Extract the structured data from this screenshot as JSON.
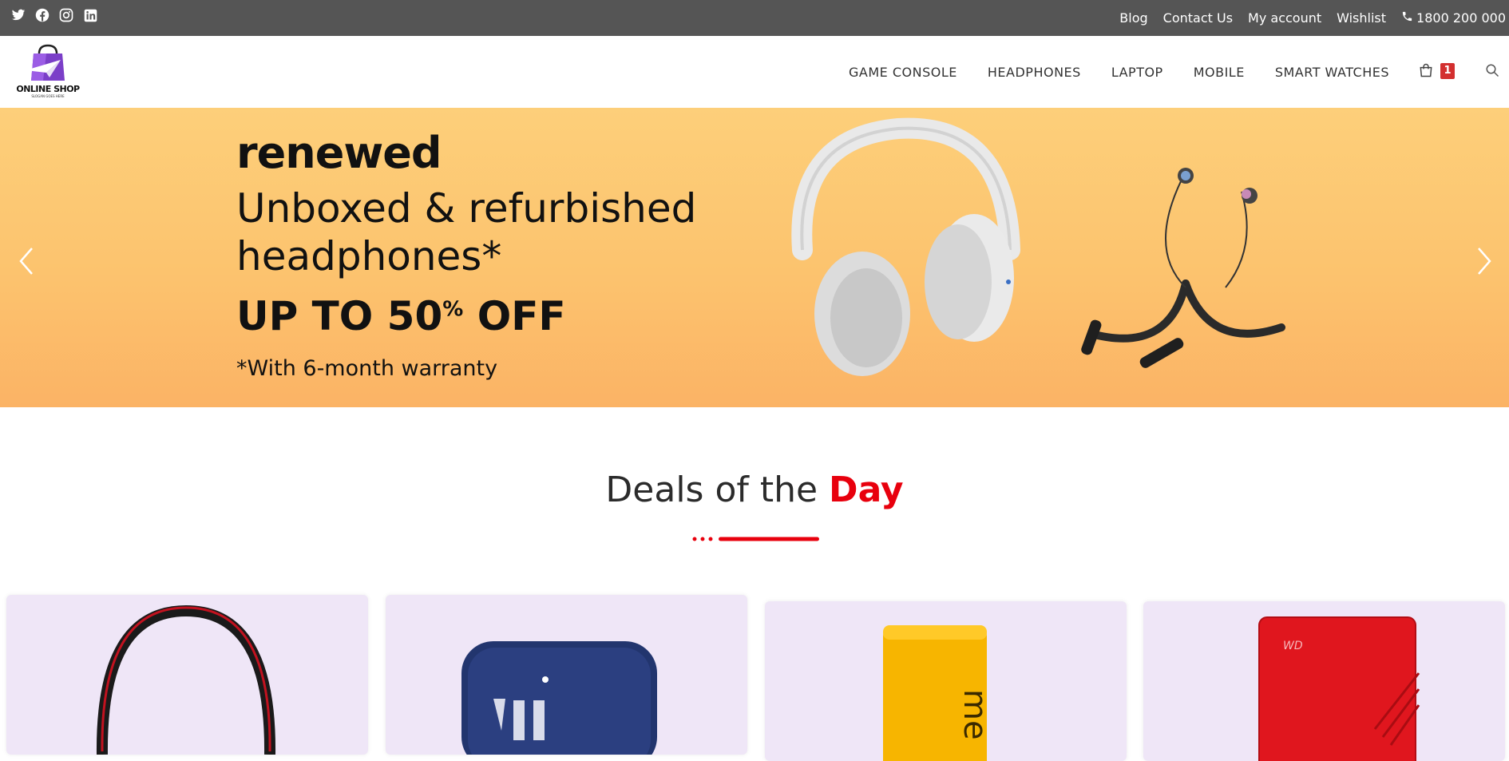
{
  "topbar": {
    "social_icons": [
      "twitter-icon",
      "facebook-icon",
      "instagram-icon",
      "linkedin-icon"
    ],
    "links": [
      "Blog",
      "Contact Us",
      "My account",
      "Wishlist"
    ],
    "phone": "1800 200 000"
  },
  "header": {
    "logo_text": "ONLINE SHOP",
    "logo_slogan": "SLOGAN GOES HERE",
    "nav": [
      "GAME CONSOLE",
      "HEADPHONES",
      "LAPTOP",
      "MOBILE",
      "SMART WATCHES"
    ],
    "cart_count": "1"
  },
  "banner": {
    "title": "renewed",
    "subtitle": "Unboxed & refurbished headphones*",
    "offer": "UP TO 50% OFF",
    "offer_main": "UP TO 50",
    "offer_sup": "%",
    "offer_end": " OFF",
    "warranty": "*With 6-month warranty"
  },
  "deals": {
    "title_plain": "Deals of the ",
    "title_accent": "Day"
  },
  "products": [
    "headphones",
    "jbl-speaker",
    "yellow-power-bank",
    "red-hard-drive"
  ],
  "colors": {
    "topbar": "#555555",
    "accent": "#e8000d",
    "badge": "#d32f2f",
    "banner": "#fcc36e",
    "card": "#efe6f7"
  }
}
